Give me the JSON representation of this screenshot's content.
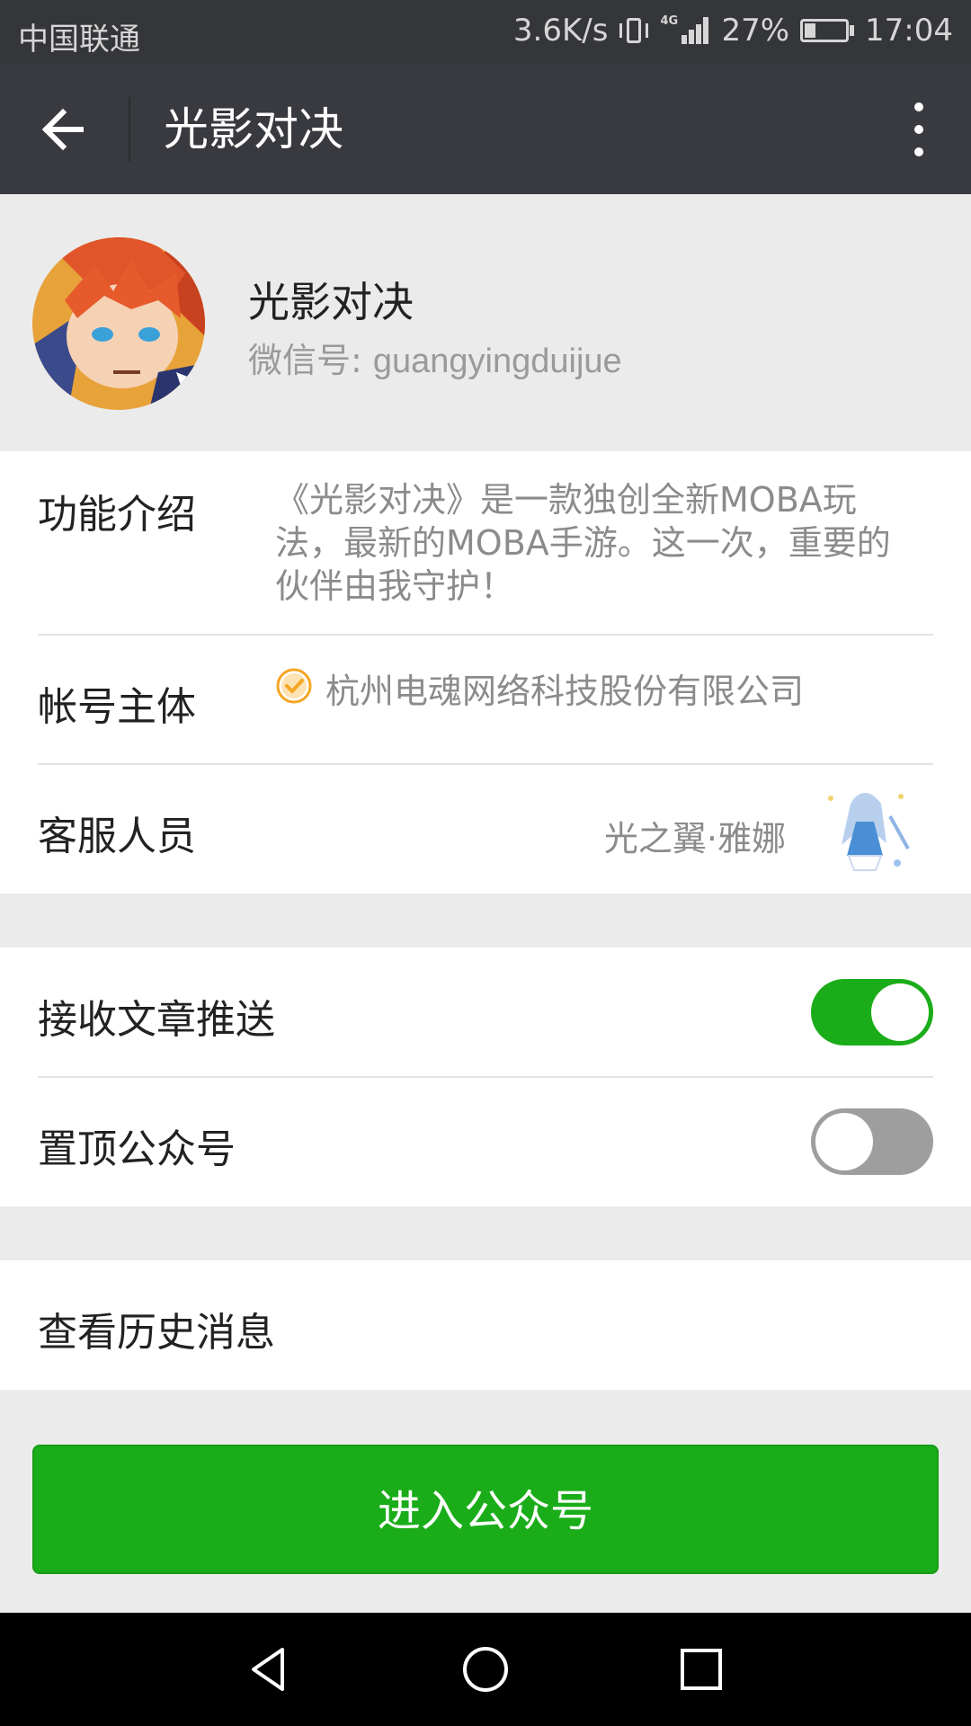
{
  "status_bar": {
    "carrier": "中国联通",
    "speed": "3.6K/s",
    "network_tag": "4G",
    "battery_level": "27%",
    "time": "17:04"
  },
  "app_bar": {
    "title": "光影对决",
    "back_icon": "arrow-left-icon",
    "more_icon": "more-vertical-icon"
  },
  "profile": {
    "name": "光影对决",
    "id_label": "微信号: ",
    "id_value": "guangyingduijue"
  },
  "info": {
    "intro_label": "功能介绍",
    "intro_text": "《光影对决》是一款独创全新MOBA玩法，最新的MOBA手游。这一次，重要的伙伴由我守护！",
    "entity_label": "帐号主体",
    "entity_text": "杭州电魂网络科技股份有限公司",
    "service_label": "客服人员",
    "service_name": "光之翼·雅娜"
  },
  "settings": {
    "receive_label": "接收文章推送",
    "receive_on": true,
    "pin_label": "置顶公众号",
    "pin_on": false
  },
  "history": {
    "label": "查看历史消息"
  },
  "enter_button": {
    "label": "进入公众号"
  },
  "colors": {
    "accent_green": "#1aad19",
    "verify_orange": "#f5a623",
    "app_bar": "#393a3f"
  }
}
